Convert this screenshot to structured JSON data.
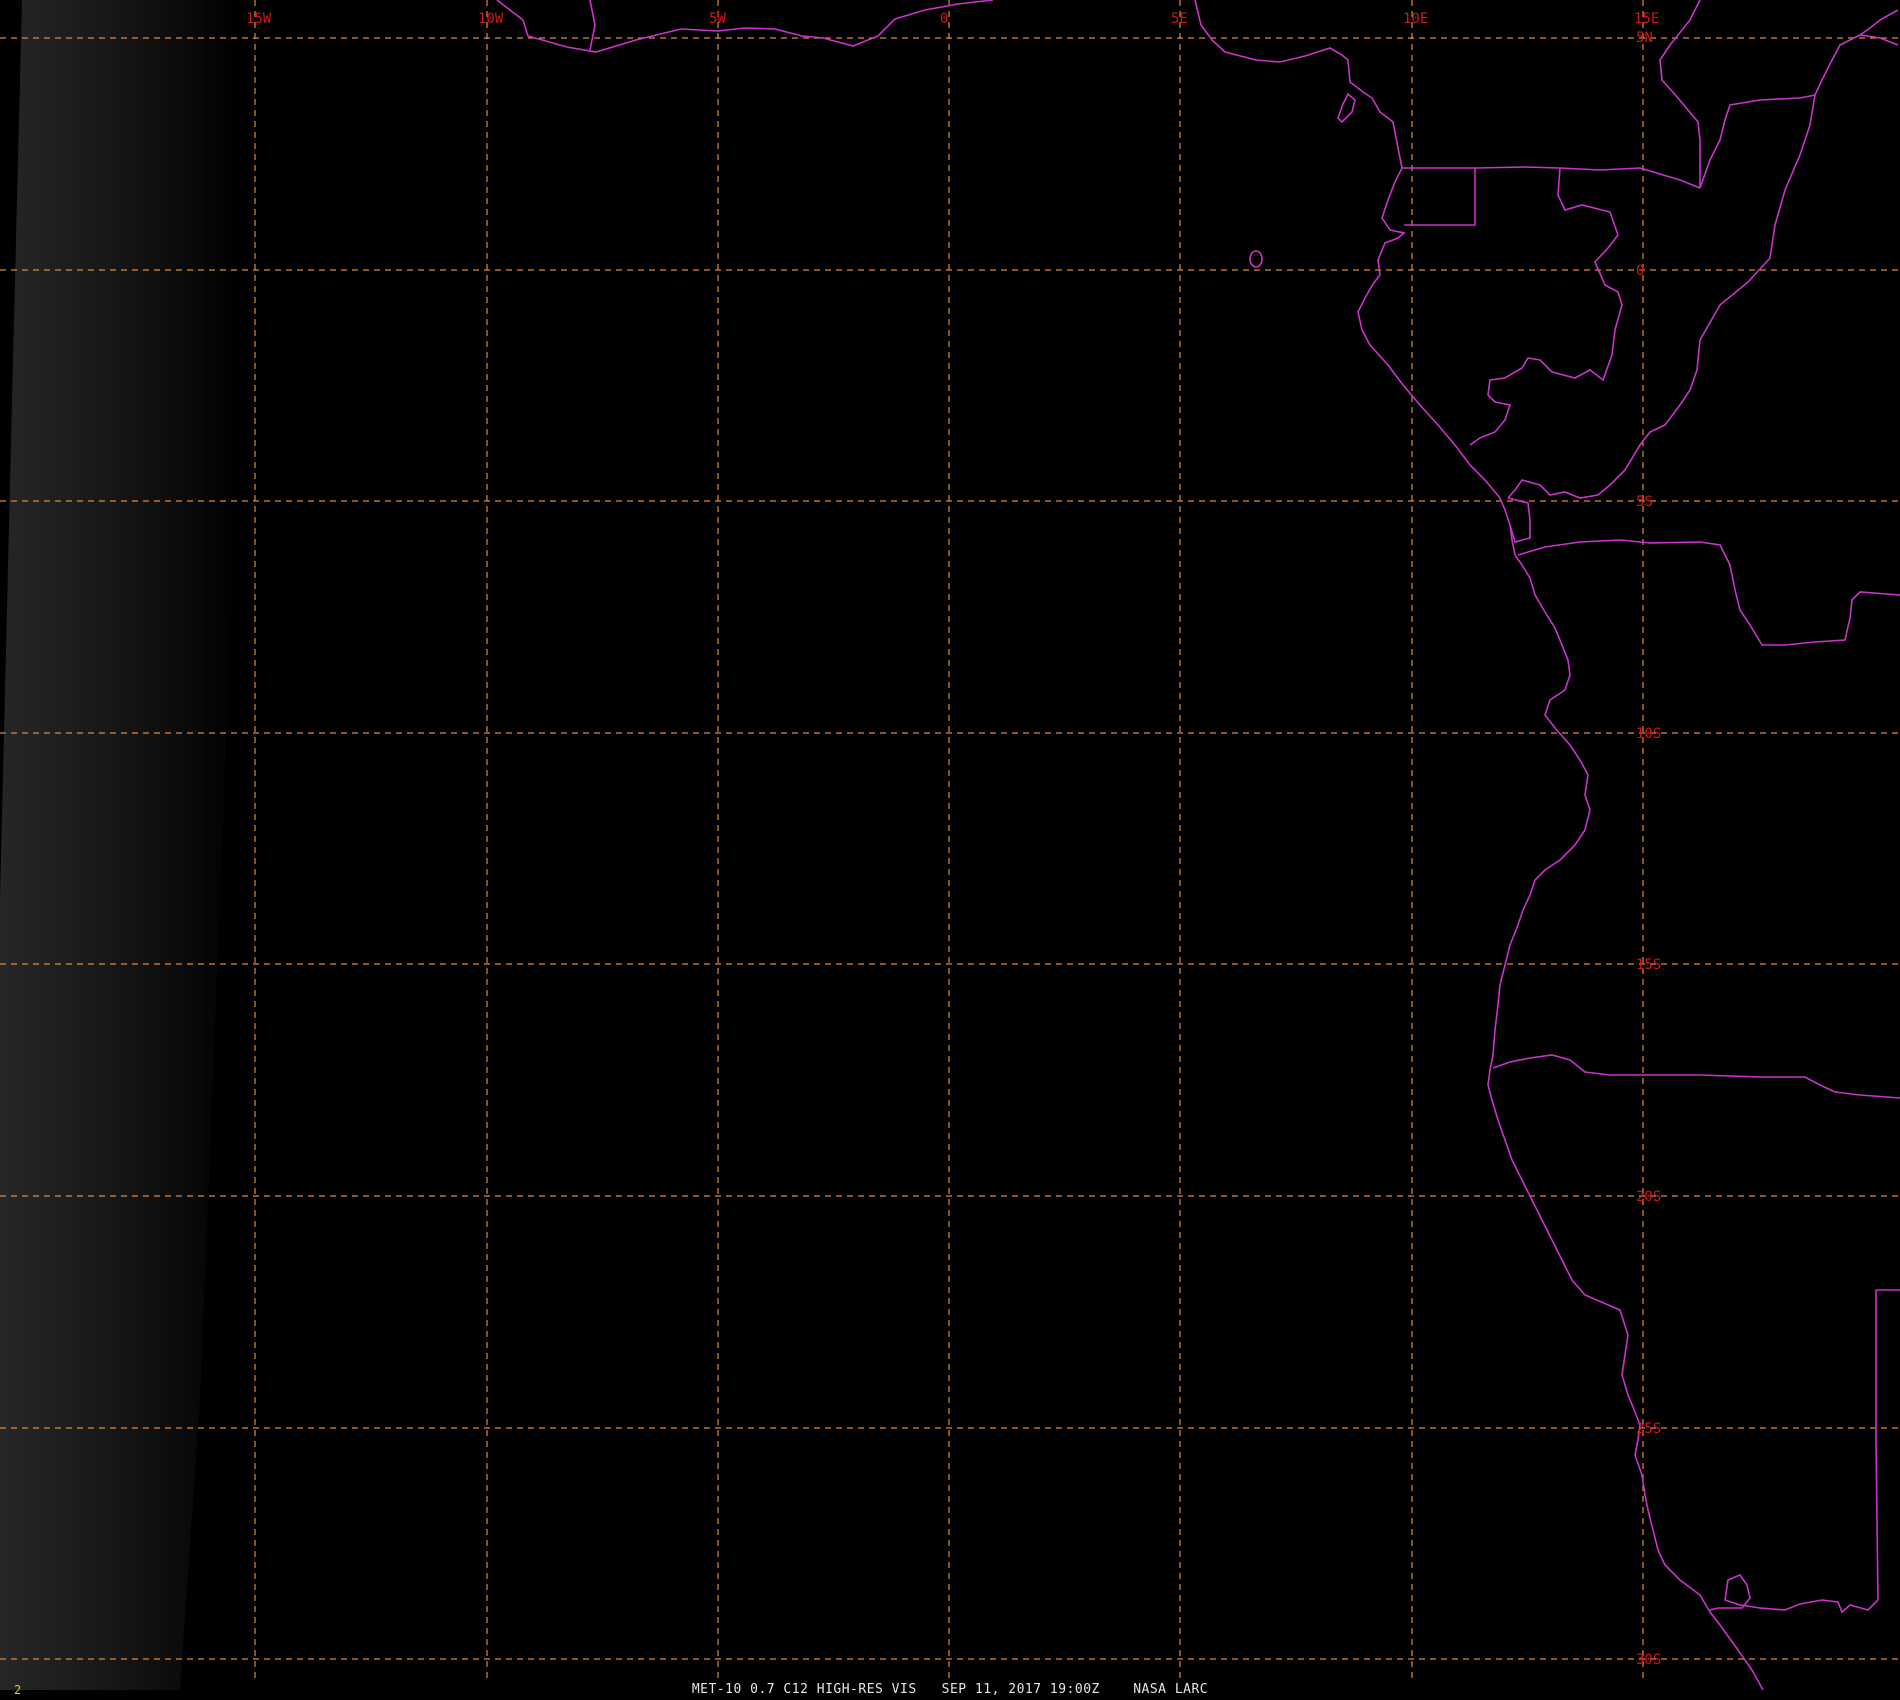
{
  "map": {
    "longitude_labels": [
      "15W",
      "10W",
      "5W",
      "0",
      "5E",
      "10E",
      "15E"
    ],
    "latitude_labels": [
      "5N",
      "0",
      "5S",
      "10S",
      "15S",
      "20S",
      "25S",
      "30S"
    ],
    "colors": {
      "background": "#000000",
      "graticule": "#e08a3a",
      "grid_labels": "#d01818",
      "coastlines": "#cc33cc",
      "caption": "#e6e6e6",
      "frame_number": "#e0d000"
    }
  },
  "caption": {
    "product": "MET-10 0.7 C12 HIGH-RES VIS",
    "datetime": "SEP 11, 2017 19:00Z",
    "source": "NASA LARC",
    "frame_number": "2"
  }
}
